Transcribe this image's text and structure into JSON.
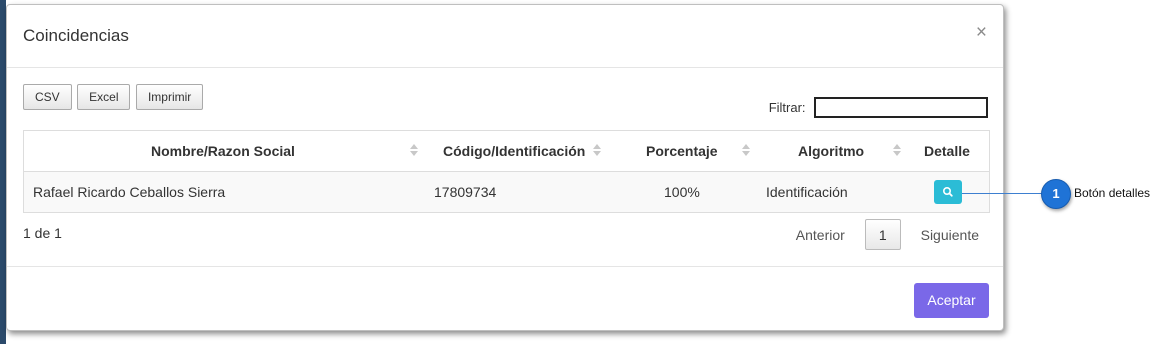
{
  "modal": {
    "title": "Coincidencias",
    "close_symbol": "×",
    "export_buttons": [
      "CSV",
      "Excel",
      "Imprimir"
    ],
    "filter_label": "Filtrar:",
    "filter_value": "",
    "table": {
      "headers": [
        "Nombre/Razon Social",
        "Código/Identificación",
        "Porcentaje",
        "Algoritmo",
        "Detalle"
      ],
      "rows": [
        {
          "nombre": "Rafael Ricardo Ceballos Sierra",
          "codigo": "17809734",
          "porcentaje": "100%",
          "algoritmo": "Identificación",
          "detalle_icon": "search-icon"
        }
      ]
    },
    "pagination": {
      "info": "1 de 1",
      "previous": "Anterior",
      "current_page": "1",
      "next": "Siguiente"
    },
    "accept_label": "Aceptar"
  },
  "callout": {
    "number": "1",
    "label": "Botón detalles"
  },
  "colors": {
    "accent": "#7a68e8",
    "detail_button": "#2bbcd6",
    "callout": "#1f73d6"
  }
}
